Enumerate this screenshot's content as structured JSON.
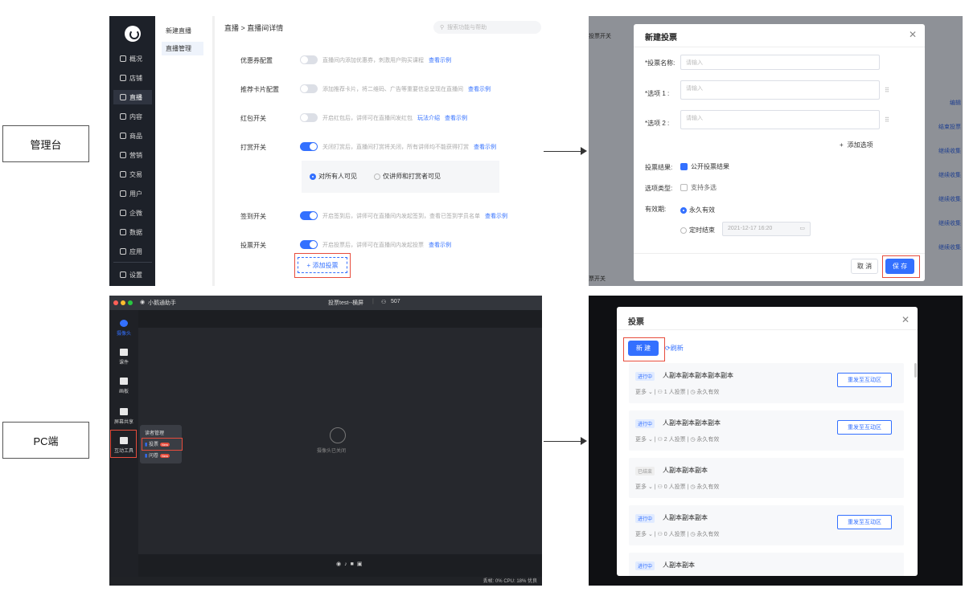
{
  "labels": {
    "admin": "管理台",
    "pc": "PC端"
  },
  "admin": {
    "nav": [
      {
        "label": "概况",
        "icon": "overview-icon"
      },
      {
        "label": "店铺",
        "icon": "shop-icon"
      },
      {
        "label": "直播",
        "icon": "live-icon"
      },
      {
        "label": "内容",
        "icon": "content-icon"
      },
      {
        "label": "商品",
        "icon": "goods-icon"
      },
      {
        "label": "营销",
        "icon": "marketing-icon"
      },
      {
        "label": "交易",
        "icon": "trade-icon"
      },
      {
        "label": "用户",
        "icon": "user-icon"
      },
      {
        "label": "企微",
        "icon": "wecom-icon"
      },
      {
        "label": "数据",
        "icon": "data-icon"
      },
      {
        "label": "应用",
        "icon": "apps-icon"
      },
      {
        "label": "设置",
        "icon": "settings-icon"
      }
    ],
    "sub": [
      "新建直播",
      "直播管理"
    ],
    "breadcrumb": "直播 > 直播间详情",
    "search_placeholder": "搜索功能与帮助",
    "rows": [
      {
        "label": "优惠券配置",
        "desc": "直播间内添加优惠券，刺激用户购买课程",
        "link": "查看示例",
        "on": false
      },
      {
        "label": "推荐卡片配置",
        "desc": "添加推荐卡片，将二维码、广告等重要信息呈现在直播间",
        "link": "查看示例",
        "on": false
      },
      {
        "label": "红包开关",
        "desc": "开启红包后，讲师可在直播间发红包",
        "link2": "玩法介绍",
        "link": "查看示例",
        "on": false
      },
      {
        "label": "打赏开关",
        "desc": "关闭打赏后，直播间打赏将关闭，所有讲师均不能获得打赏",
        "link": "查看示例",
        "on": true
      },
      {
        "label": "签到开关",
        "desc": "开启签到后，讲师可在直播间内发起签到，查看已签到学员名单",
        "link": "查看示例",
        "on": true
      },
      {
        "label": "投票开关",
        "desc": "开启投票后，讲师可在直播间内发起投票",
        "link": "查看示例",
        "on": true
      }
    ],
    "visibility": {
      "opt1": "对所有人可见",
      "opt2": "仅讲师和打赏者可见"
    },
    "add_vote": "+ 添加投票"
  },
  "new_vote": {
    "bg_left_text": "投票开关",
    "bg_right_items": [
      "编辑",
      "结束投票",
      "继续收集",
      "继续收集",
      "继续收集",
      "继续收集",
      "继续收集"
    ],
    "bg_bottom_text": "票开关",
    "title": "新建投票",
    "name_label": "*投票名称:",
    "name_placeholder": "请输入",
    "opt1_label": "*选项 1 :",
    "opt2_label": "*选项 2 :",
    "opt_placeholder": "请输入",
    "add_option": "添加选项",
    "result_label": "投票结果:",
    "result_value": "公开投票结果",
    "type_label": "选项类型:",
    "type_value": "支持多选",
    "valid_label": "有效期:",
    "valid_opt1": "永久有效",
    "valid_opt2": "定时结束",
    "valid_date": "2021-12-17 16:20",
    "cancel": "取 消",
    "save": "保 存"
  },
  "pc": {
    "app_name": "小鹅通助手",
    "window_title": "投票test--横屏",
    "viewer_count": "507",
    "tools": [
      "摄像头",
      "课件",
      "画板",
      "屏幕共享",
      "互动工具"
    ],
    "popup_title": "读者管理",
    "popup_items": [
      "投票",
      "问卷"
    ],
    "badge": "New",
    "camera_off": "摄像头已关闭",
    "status": "丢帧: 0%  CPU: 18%  优良"
  },
  "vote_list": {
    "title": "投票",
    "new_btn": "新 建",
    "refresh": "刷新",
    "push_btn": "重发至互动区",
    "items": [
      {
        "status": "进行中",
        "title": "人副本副本副本副本副本",
        "more": "更多",
        "count": "1 人投票",
        "valid": "永久有效",
        "ended": false
      },
      {
        "status": "进行中",
        "title": "人副本副本副本副本",
        "more": "更多",
        "count": "2 人投票",
        "valid": "永久有效",
        "ended": false
      },
      {
        "status": "已结束",
        "title": "人副本副本副本",
        "more": "更多",
        "count": "0 人投票",
        "valid": "永久有效",
        "ended": true
      },
      {
        "status": "进行中",
        "title": "人副本副本副本",
        "more": "更多",
        "count": "0 人投票",
        "valid": "永久有效",
        "ended": false
      },
      {
        "status": "进行中",
        "title": "人副本副本",
        "more": "更多",
        "count": "",
        "valid": "",
        "ended": false
      }
    ]
  }
}
